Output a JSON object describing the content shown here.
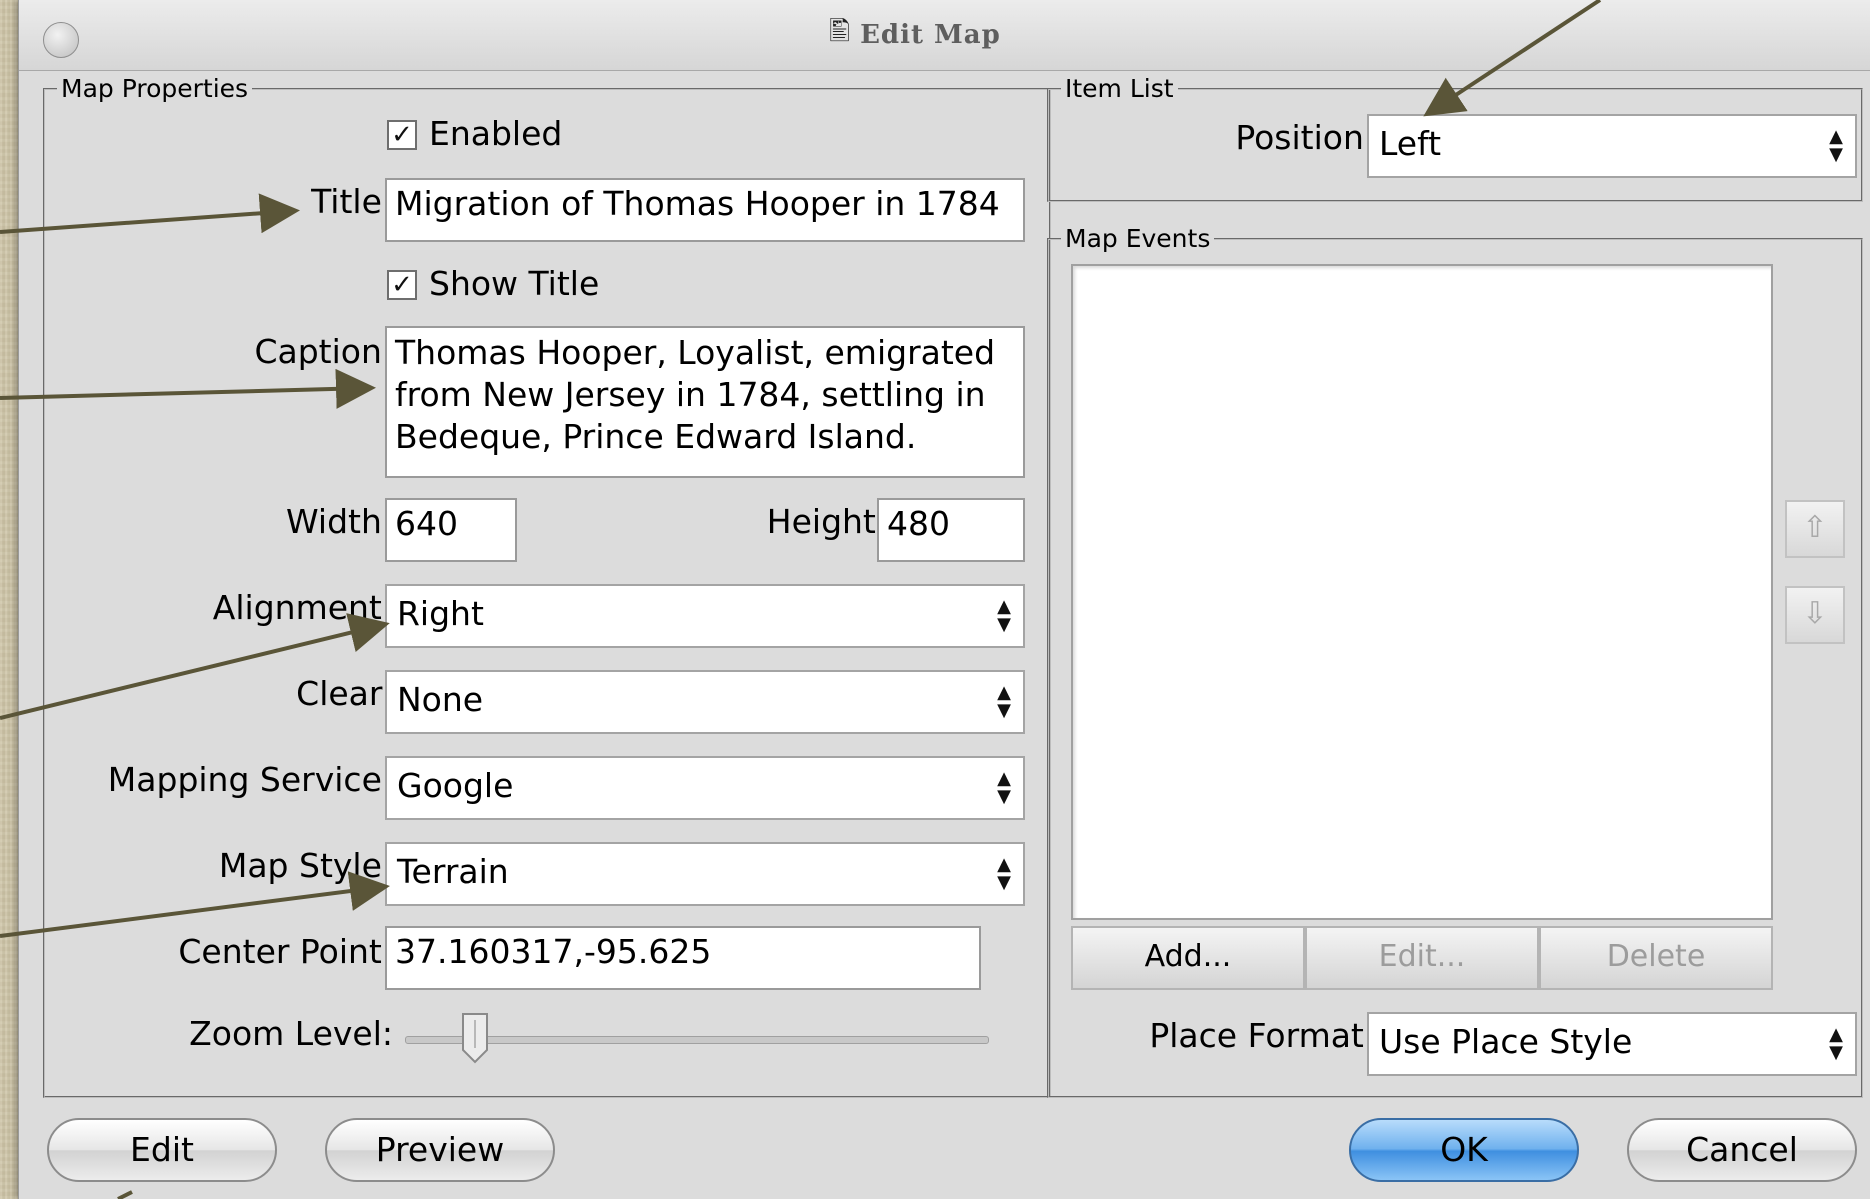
{
  "window": {
    "title": "Edit Map"
  },
  "map_properties": {
    "legend": "Map Properties",
    "enabled_label": "Enabled",
    "enabled_checked": true,
    "title_label": "Title:",
    "title_value": "Migration of Thomas Hooper in 1784",
    "show_title_label": "Show Title",
    "show_title_checked": true,
    "caption_label": "Caption:",
    "caption_value": "Thomas Hooper, Loyalist, emigrated from New Jersey in 1784, settling in Bedeque, Prince Edward Island.",
    "width_label": "Width:",
    "width_value": "640",
    "height_label": "Height:",
    "height_value": "480",
    "alignment_label": "Alignment:",
    "alignment_value": "Right",
    "clear_label": "Clear:",
    "clear_value": "None",
    "mapping_service_label": "Mapping Service:",
    "mapping_service_value": "Google",
    "map_style_label": "Map Style:",
    "map_style_value": "Terrain",
    "center_point_label": "Center Point:",
    "center_point_value": "37.160317,-95.625",
    "zoom_level_label": "Zoom Level:",
    "zoom_level_fraction": 0.12
  },
  "item_list": {
    "legend": "Item List",
    "position_label": "Position:",
    "position_value": "Left"
  },
  "map_events": {
    "legend": "Map Events",
    "add_label": "Add...",
    "edit_label": "Edit...",
    "delete_label": "Delete",
    "place_format_label": "Place Format:",
    "place_format_value": "Use Place Style"
  },
  "footer": {
    "edit_label": "Edit",
    "preview_label": "Preview",
    "ok_label": "OK",
    "cancel_label": "Cancel"
  },
  "colors": {
    "annotation_arrow": "#5a5538",
    "default_button": "#4f9be6",
    "dialog_background": "#dcdcdc"
  },
  "icons": {
    "title_icon": "map-icon",
    "move_up": "arrow-up-icon",
    "move_down": "arrow-down-icon"
  }
}
